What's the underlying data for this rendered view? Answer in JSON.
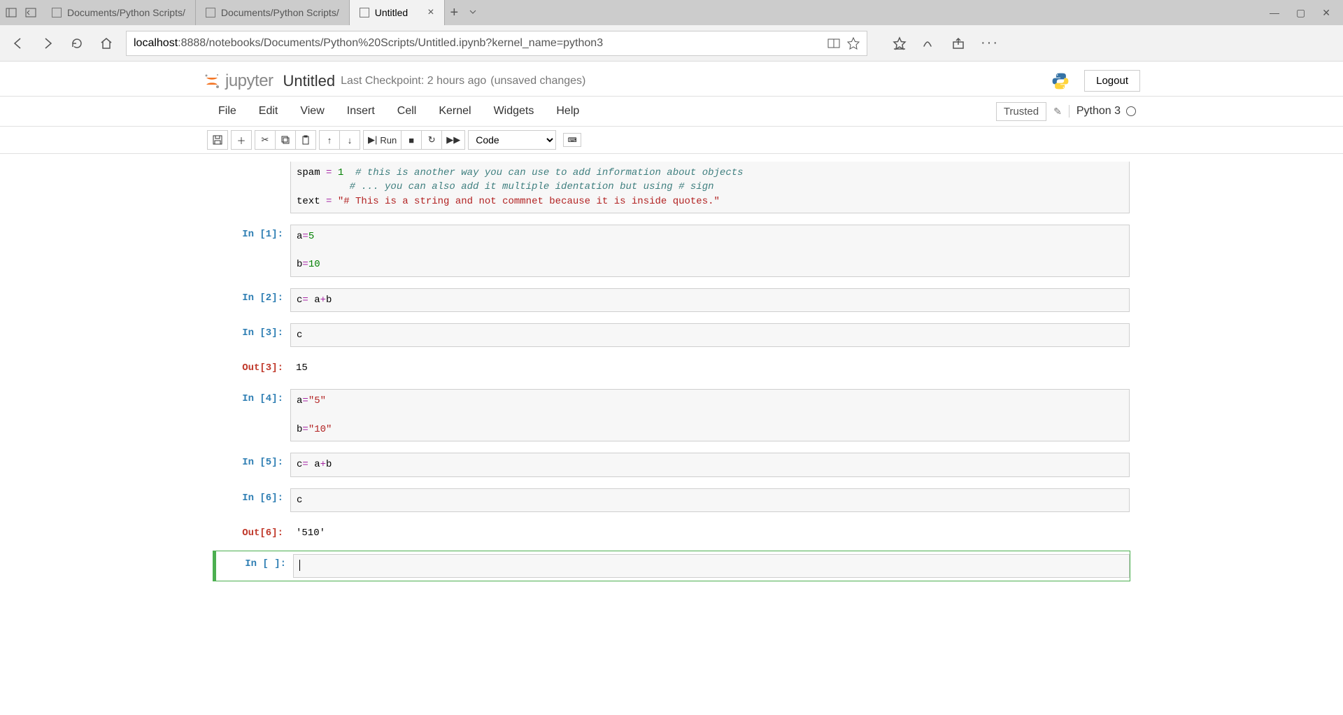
{
  "browser": {
    "tabs": [
      {
        "label": "Documents/Python Scripts/"
      },
      {
        "label": "Documents/Python Scripts/"
      },
      {
        "label": "Untitled",
        "active": true
      }
    ],
    "url_host": "localhost",
    "url_rest": ":8888/notebooks/Documents/Python%20Scripts/Untitled.ipynb?kernel_name=python3"
  },
  "header": {
    "logo_text": "jupyter",
    "title": "Untitled",
    "checkpoint": "Last Checkpoint: 2 hours ago",
    "unsaved": "(unsaved changes)",
    "logout": "Logout"
  },
  "menu": {
    "items": [
      "File",
      "Edit",
      "View",
      "Insert",
      "Cell",
      "Kernel",
      "Widgets",
      "Help"
    ],
    "trusted": "Trusted",
    "kernel": "Python 3"
  },
  "toolbar": {
    "run_label": "Run",
    "cell_type": "Code"
  },
  "cells": {
    "topPartial": {
      "line1_var": "spam",
      "line1_op": " = ",
      "line1_num": "1",
      "line1_com": "  # this is another way you can use to add information about objects",
      "line2_com": "         # ... you can also add it multiple identation but using # sign",
      "line3_var": "text",
      "line3_op": " = ",
      "line3_str": "\"# This is a string and not commnet because it is inside quotes.\""
    },
    "c1": {
      "prompt": "In [1]:",
      "l1_a": "a",
      "l1_eq": "=",
      "l1_v": "5",
      "l2": "",
      "l3_a": "b",
      "l3_eq": "=",
      "l3_v": "10"
    },
    "c2": {
      "prompt": "In [2]:",
      "l1_a": "c",
      "l1_eq": "= ",
      "l1_b": "a",
      "l1_plus": "+",
      "l1_c": "b"
    },
    "c3": {
      "prompt": "In [3]:",
      "body": "c",
      "out_prompt": "Out[3]:",
      "out_val": "15"
    },
    "c4": {
      "prompt": "In [4]:",
      "l1_a": "a",
      "l1_eq": "=",
      "l1_v": "\"5\"",
      "l2": "",
      "l3_a": "b",
      "l3_eq": "=",
      "l3_v": "\"10\""
    },
    "c5": {
      "prompt": "In [5]:",
      "l1_a": "c",
      "l1_eq": "= ",
      "l1_b": "a",
      "l1_plus": "+",
      "l1_c": "b"
    },
    "c6": {
      "prompt": "In [6]:",
      "body": "c",
      "out_prompt": "Out[6]:",
      "out_val": "'510'"
    },
    "c7": {
      "prompt": "In [ ]:"
    }
  }
}
